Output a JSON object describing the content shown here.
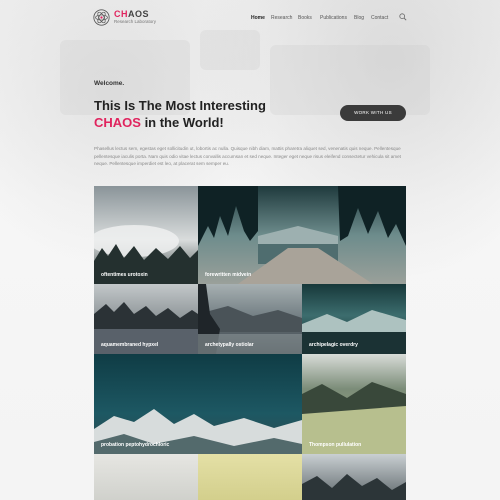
{
  "brand": {
    "title_accent": "CH",
    "title_rest": "AOS",
    "subtitle": "Research Laboratory",
    "accent_color": "#e0245e"
  },
  "nav": {
    "items": [
      "Home",
      "Research",
      "Books",
      "Publications",
      "Blog",
      "Contact"
    ],
    "active": "Home",
    "search_icon": "search-icon"
  },
  "hero": {
    "welcome": "Welcome.",
    "headline_line1": "This Is The Most Interesting",
    "headline_accent": "CHAOS",
    "headline_line2_rest": " in the World!",
    "cta_label": "WORK WITH US",
    "intro": "Phasellus lectus sem, egestas eget sollicitudin ut, lobortis ac nulla. Quisque nibh diam, mattis pharetra aliquet sed, venenatis quis neque. Pellentesque pellentesque iaculis porta. Nam quis odio vitae lectus convallis accumsan et sed neque. Integer eget neque risus eleifend consectetur vehicula sit amet neque. Pellentesque imperdiet est leo, at placerat sem semper eu."
  },
  "gallery": {
    "tiles": [
      "oftentimes urotoxin",
      "forewritten midvein",
      "aquamembraned hypxel",
      "archetypally ostiolar",
      "archipelagic overdry",
      "probation peptohydrochloric",
      "",
      "Thompson pullulation",
      "",
      "",
      ""
    ]
  }
}
